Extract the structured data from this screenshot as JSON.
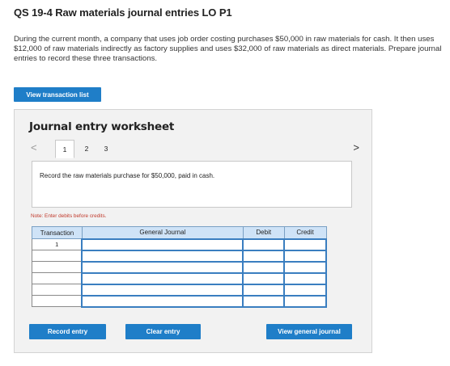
{
  "header": {
    "title": "QS 19-4 Raw materials journal entries LO P1"
  },
  "problem": {
    "text": "During the current month, a company that uses job order costing purchases $50,000 in raw materials for cash. It then uses $12,000 of raw materials indirectly as factory supplies and uses $32,000 of raw materials as direct materials. Prepare journal entries to record these three transactions."
  },
  "buttons": {
    "view_transaction_list": "View transaction list",
    "record_entry": "Record entry",
    "clear_entry": "Clear entry",
    "view_general_journal": "View general journal"
  },
  "worksheet": {
    "title": "Journal entry worksheet",
    "tabs": [
      "1",
      "2",
      "3"
    ],
    "active_tab": "1",
    "prev_arrow": "<",
    "next_arrow": ">",
    "instruction": "Record the raw materials purchase for $50,000, paid in cash.",
    "note": "Note: Enter debits before credits."
  },
  "journal_table": {
    "columns": [
      "Transaction",
      "General Journal",
      "Debit",
      "Credit"
    ],
    "rows": [
      {
        "transaction": "1",
        "general_journal": "",
        "debit": "",
        "credit": ""
      },
      {
        "transaction": "",
        "general_journal": "",
        "debit": "",
        "credit": ""
      },
      {
        "transaction": "",
        "general_journal": "",
        "debit": "",
        "credit": ""
      },
      {
        "transaction": "",
        "general_journal": "",
        "debit": "",
        "credit": ""
      },
      {
        "transaction": "",
        "general_journal": "",
        "debit": "",
        "credit": ""
      },
      {
        "transaction": "",
        "general_journal": "",
        "debit": "",
        "credit": ""
      }
    ]
  },
  "colors": {
    "button_blue": "#1f7ec8",
    "header_blue": "#cfe3f7",
    "input_border": "#3a7ec0",
    "note_red": "#c0392b"
  }
}
